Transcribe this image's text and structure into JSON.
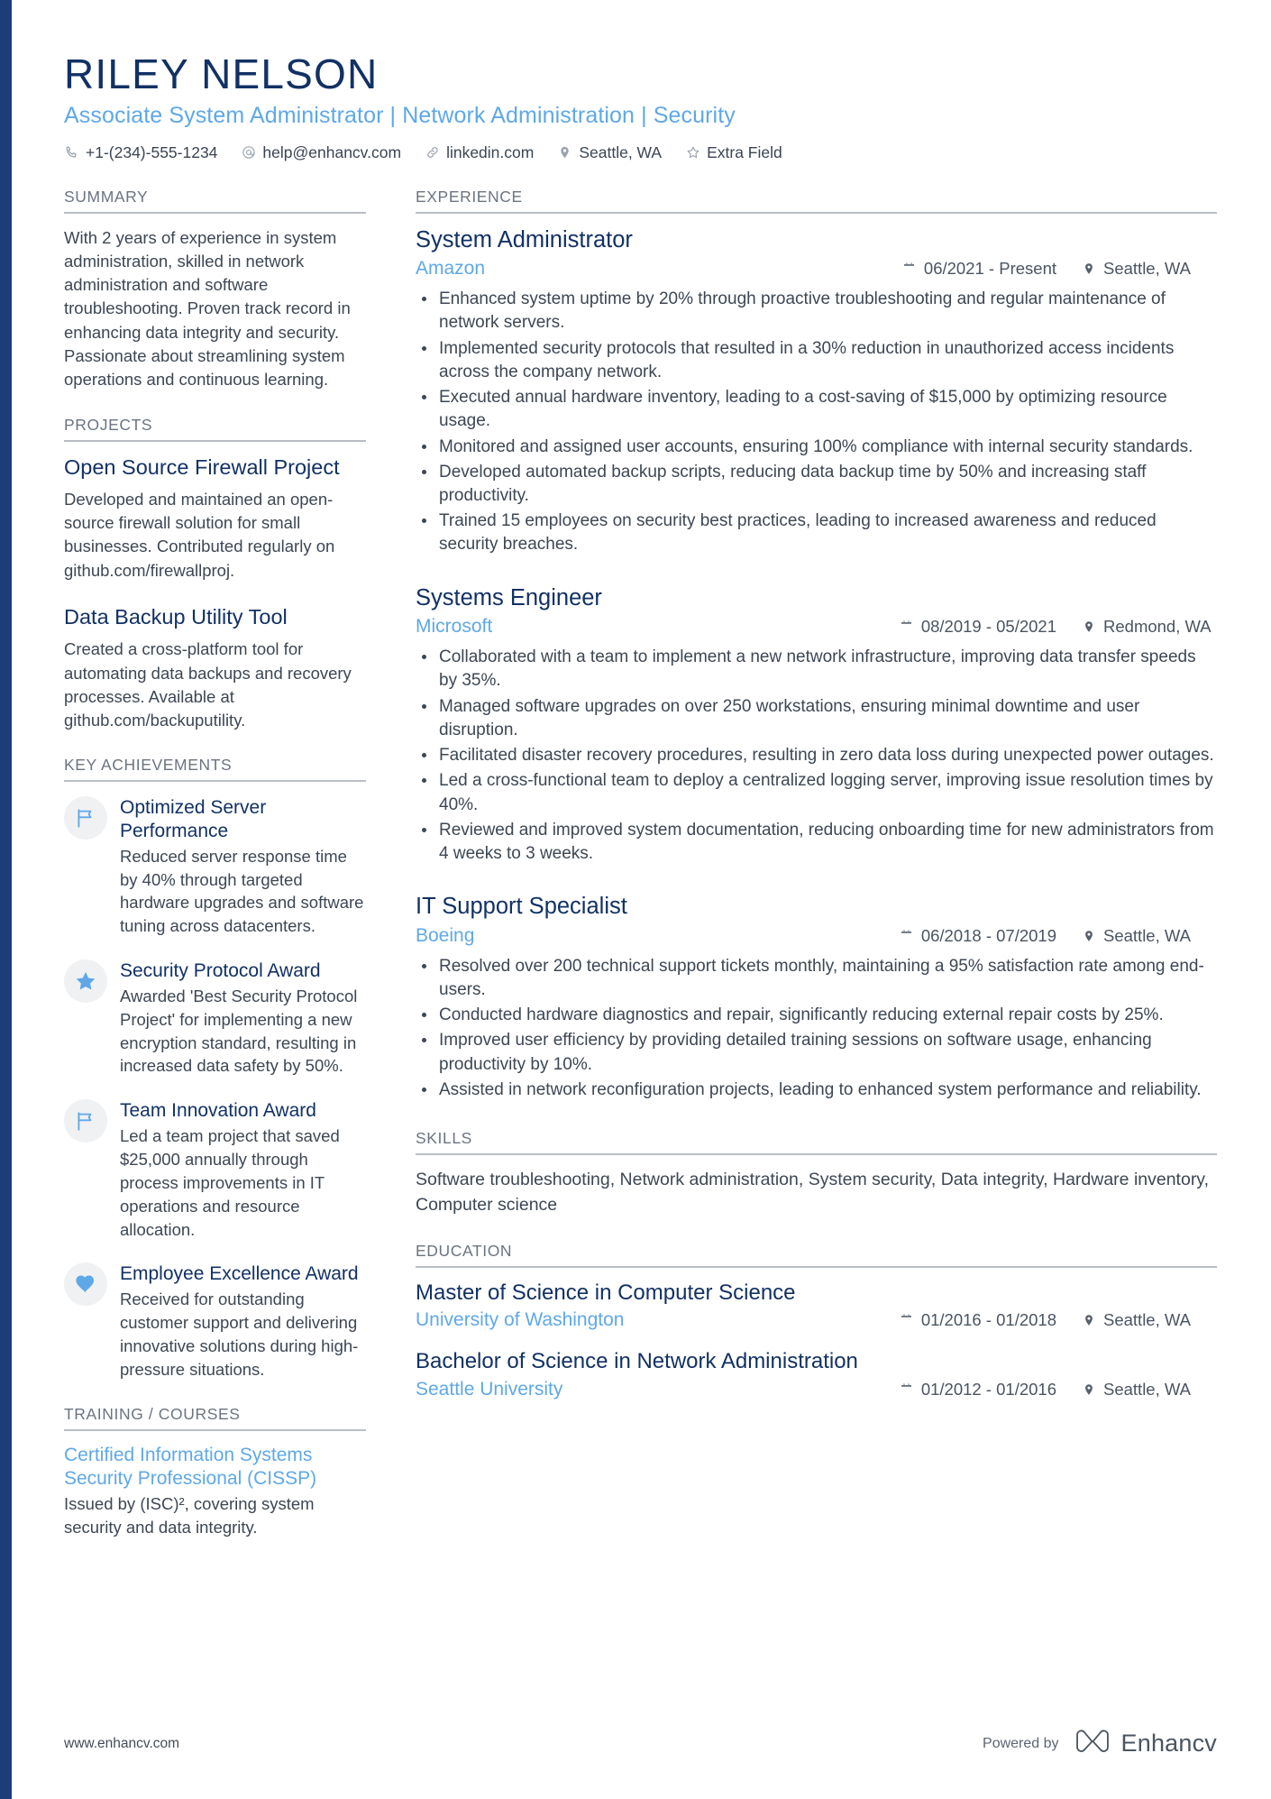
{
  "theme": {
    "navy": "#123164",
    "blue": "#5fa8e8",
    "edge_bar": "#1d3d78",
    "body_text": "#3d4753",
    "muted": "#6b7480"
  },
  "header": {
    "name": "RILEY NELSON",
    "headline": "Associate System Administrator | Network Administration | Security",
    "contacts": [
      {
        "icon": "phone-icon",
        "text": "+1-(234)-555-1234"
      },
      {
        "icon": "email-icon",
        "text": "help@enhancv.com"
      },
      {
        "icon": "link-icon",
        "text": "linkedin.com"
      },
      {
        "icon": "location-pin-icon",
        "text": "Seattle, WA"
      },
      {
        "icon": "star-outline-icon",
        "text": "Extra Field"
      }
    ]
  },
  "left": {
    "summary": {
      "title": "SUMMARY",
      "text": "With 2 years of experience in system administration, skilled in network administration and software troubleshooting. Proven track record in enhancing data integrity and security. Passionate about streamlining system operations and continuous learning."
    },
    "projects": {
      "title": "PROJECTS",
      "items": [
        {
          "name": "Open Source Firewall Project",
          "description": "Developed and maintained an open-source firewall solution for small businesses. Contributed regularly on github.com/firewallproj."
        },
        {
          "name": "Data Backup Utility Tool",
          "description": "Created a cross-platform tool for automating data backups and recovery processes. Available at github.com/backuputility."
        }
      ]
    },
    "achievements": {
      "title": "KEY ACHIEVEMENTS",
      "items": [
        {
          "icon": "flag-icon",
          "title": "Optimized Server Performance",
          "description": "Reduced server response time by 40% through targeted hardware upgrades and software tuning across datacenters."
        },
        {
          "icon": "star-icon",
          "title": "Security Protocol Award",
          "description": "Awarded 'Best Security Protocol Project' for implementing a new encryption standard, resulting in increased data safety by 50%."
        },
        {
          "icon": "flag-icon",
          "title": "Team Innovation Award",
          "description": "Led a team project that saved $25,000 annually through process improvements in IT operations and resource allocation."
        },
        {
          "icon": "heart-icon",
          "title": "Employee Excellence Award",
          "description": "Received for outstanding customer support and delivering innovative solutions during high-pressure situations."
        }
      ]
    },
    "training": {
      "title": "TRAINING / COURSES",
      "items": [
        {
          "name": "Certified Information Systems Security Professional (CISSP)",
          "description": "Issued by (ISC)², covering system security and data integrity."
        }
      ]
    }
  },
  "right": {
    "experience": {
      "title": "EXPERIENCE",
      "jobs": [
        {
          "role": "System Administrator",
          "company": "Amazon",
          "date": "06/2021 - Present",
          "location": "Seattle, WA",
          "bullets": [
            "Enhanced system uptime by 20% through proactive troubleshooting and regular maintenance of network servers.",
            "Implemented security protocols that resulted in a 30% reduction in unauthorized access incidents across the company network.",
            "Executed annual hardware inventory, leading to a cost-saving of $15,000 by optimizing resource usage.",
            "Monitored and assigned user accounts, ensuring 100% compliance with internal security standards.",
            "Developed automated backup scripts, reducing data backup time by 50% and increasing staff productivity.",
            "Trained 15 employees on security best practices, leading to increased awareness and reduced security breaches."
          ]
        },
        {
          "role": "Systems Engineer",
          "company": "Microsoft",
          "date": "08/2019 - 05/2021",
          "location": "Redmond, WA",
          "bullets": [
            "Collaborated with a team to implement a new network infrastructure, improving data transfer speeds by 35%.",
            "Managed software upgrades on over 250 workstations, ensuring minimal downtime and user disruption.",
            "Facilitated disaster recovery procedures, resulting in zero data loss during unexpected power outages.",
            "Led a cross-functional team to deploy a centralized logging server, improving issue resolution times by 40%.",
            "Reviewed and improved system documentation, reducing onboarding time for new administrators from 4 weeks to 3 weeks."
          ]
        },
        {
          "role": "IT Support Specialist",
          "company": "Boeing",
          "date": "06/2018 - 07/2019",
          "location": "Seattle, WA",
          "bullets": [
            "Resolved over 200 technical support tickets monthly, maintaining a 95% satisfaction rate among end-users.",
            "Conducted hardware diagnostics and repair, significantly reducing external repair costs by 25%.",
            "Improved user efficiency by providing detailed training sessions on software usage, enhancing productivity by 10%.",
            "Assisted in network reconfiguration projects, leading to enhanced system performance and reliability."
          ]
        }
      ]
    },
    "skills": {
      "title": "SKILLS",
      "text": "Software troubleshooting, Network administration, System security, Data integrity, Hardware inventory, Computer science"
    },
    "education": {
      "title": "EDUCATION",
      "items": [
        {
          "degree": "Master of Science in Computer Science",
          "school": "University of Washington",
          "date": "01/2016 - 01/2018",
          "location": "Seattle, WA"
        },
        {
          "degree": "Bachelor of Science in Network Administration",
          "school": "Seattle University",
          "date": "01/2012 - 01/2016",
          "location": "Seattle, WA"
        }
      ]
    }
  },
  "footer": {
    "url": "www.enhancv.com",
    "powered_by": "Powered by",
    "brand": "Enhancv"
  }
}
